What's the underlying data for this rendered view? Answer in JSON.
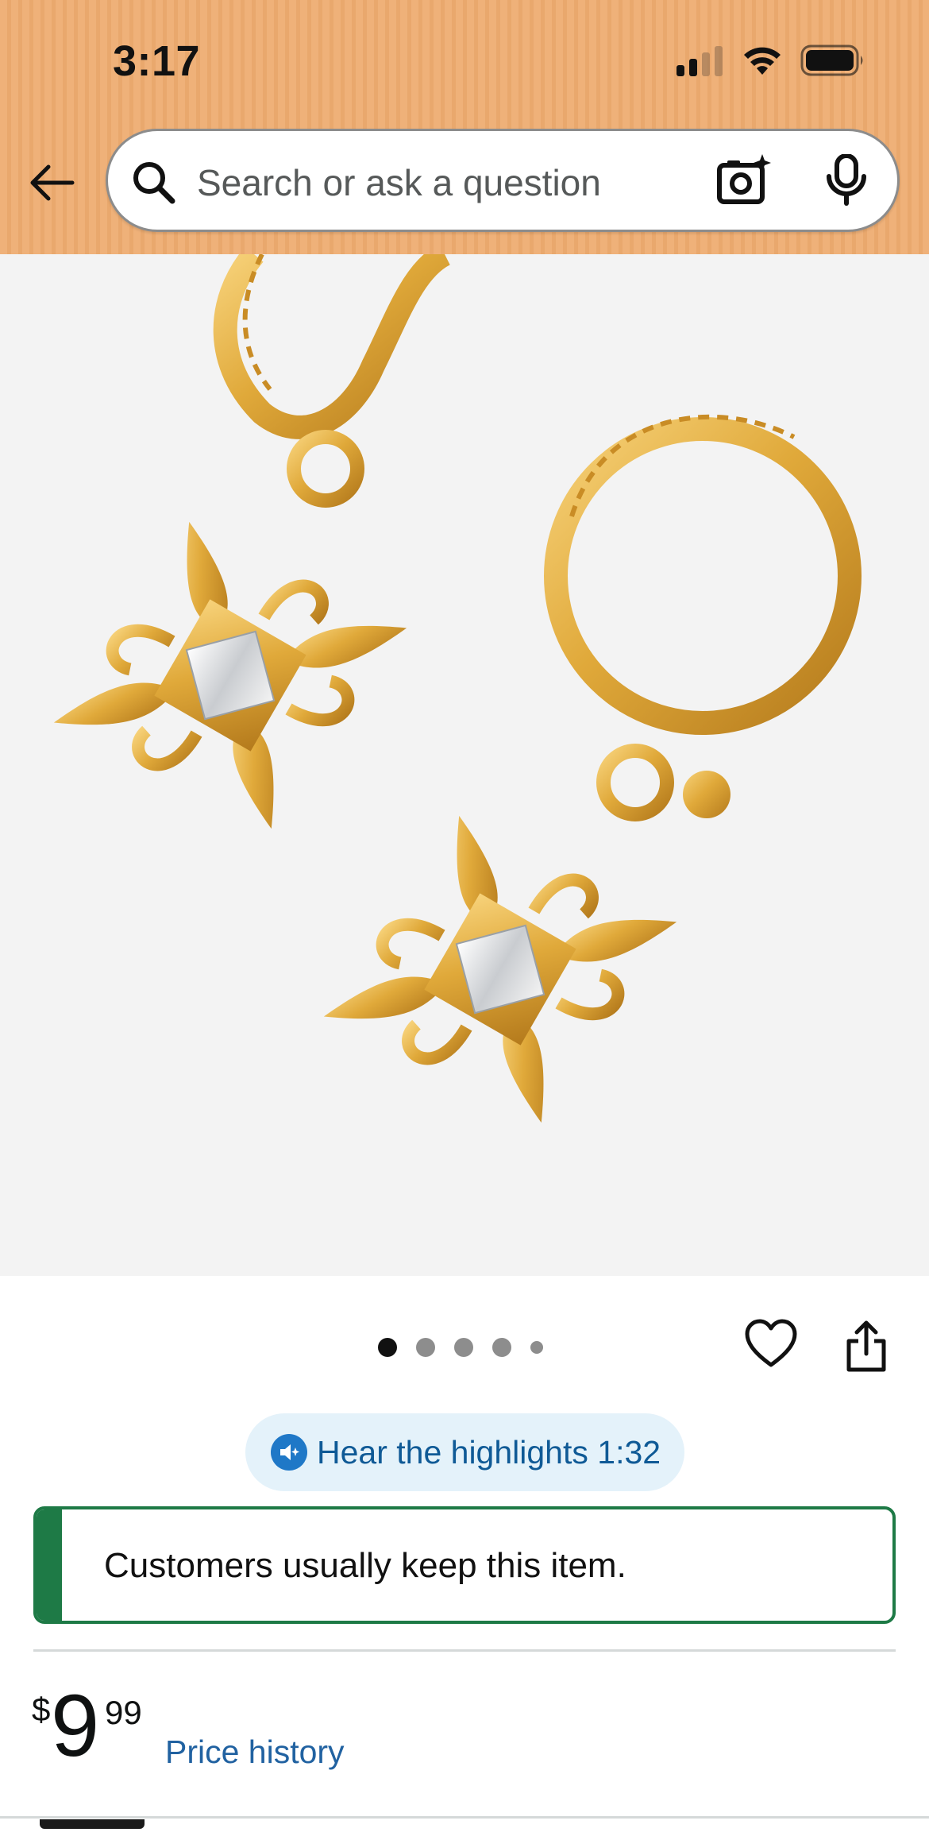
{
  "status_bar": {
    "time": "3:17",
    "icons": [
      "signal-icon",
      "wifi-icon",
      "battery-icon"
    ]
  },
  "header": {
    "back_icon": "back-arrow-icon",
    "search": {
      "placeholder": "Search or ask a question",
      "icons": [
        "search-icon",
        "camera-icon",
        "mic-icon"
      ]
    }
  },
  "product": {
    "image_description_icon": "product-image",
    "carousel": {
      "total": 5,
      "active": 1
    },
    "actions": [
      "heart-icon",
      "share-icon"
    ],
    "highlights_button": "Hear the highlights 1:32",
    "keep_message": "Customers usually keep this item.",
    "price": {
      "symbol": "$",
      "whole": "9",
      "fraction": "99"
    },
    "price_history_link": "Price history"
  },
  "colors": {
    "header_bg": "#efb179",
    "keep_green": "#1e7a46",
    "link_blue": "#2162a1",
    "pill_bg": "#e4f2fa"
  }
}
